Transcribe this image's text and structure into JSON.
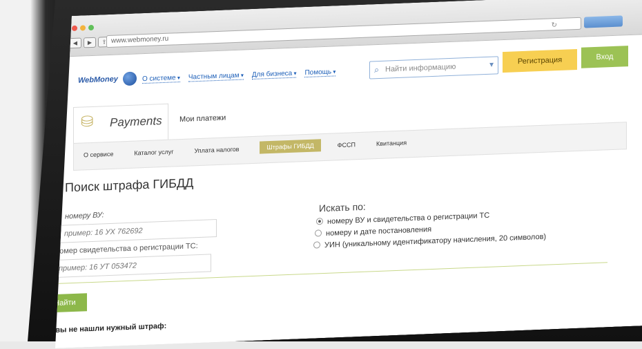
{
  "browser": {
    "url": "www.webmoney.ru"
  },
  "header": {
    "logo": "WebMoney",
    "menu": [
      "О системе",
      "Частным лицам",
      "Для бизнеса",
      "Помощь"
    ],
    "search_placeholder": "Найти информацию",
    "register_label": "Регистрация",
    "login_label": "Вход"
  },
  "payments": {
    "title": "Payments",
    "my_payments": "Мои платежи",
    "subnav": [
      "О сервисе",
      "Каталог услуг",
      "Уплата налогов",
      "Штрафы ГИБДД",
      "ФССП",
      "Квитанция"
    ],
    "active_index": 3
  },
  "form": {
    "title": "Поиск штрафа ГИБДД",
    "vu_label": "номеру ВУ:",
    "vu_placeholder": "пример: 16 УХ 762692",
    "sv_label": "номер свидетельства о регистрации ТС:",
    "sv_placeholder": "пример: 16 УТ 053472",
    "search_by_label": "Искать по:",
    "options": [
      "номеру ВУ и свидетельства о регистрации ТС",
      "номеру и дате постановления",
      "УИН (уникальному идентификатору начисления, 20 символов)"
    ],
    "selected_option": 0,
    "find_label": "Найти",
    "not_found": "Если вы не нашли нужный штраф:"
  }
}
